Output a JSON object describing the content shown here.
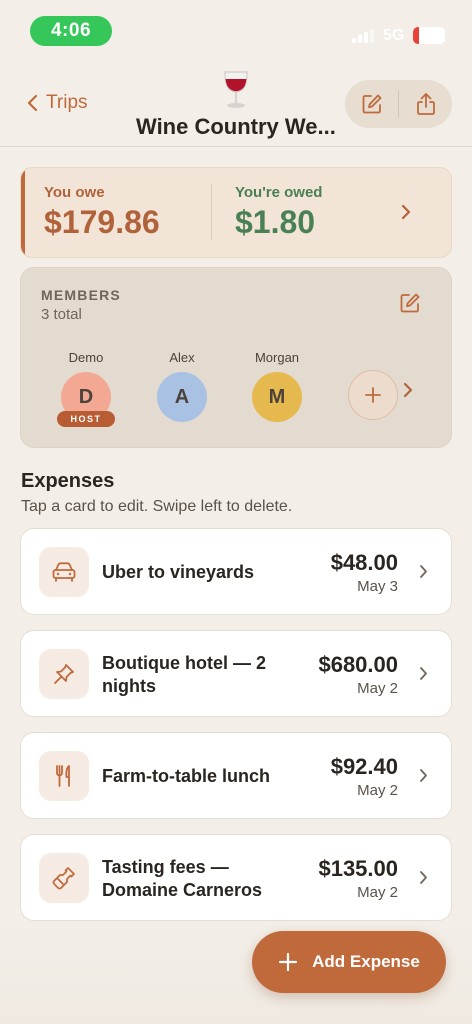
{
  "status_bar": {
    "time": "4:06",
    "network": "5G",
    "battery": "19",
    "battery_level": 0.19
  },
  "header": {
    "back_label": "Trips",
    "title": "Wine Country We...",
    "emoji_icon": "wine-glass-icon",
    "actions": [
      "edit-icon",
      "share-icon"
    ]
  },
  "balance": {
    "you_owe_label": "You owe",
    "you_owe_amount": "$179.86",
    "you_are_owed_label": "You're owed",
    "you_are_owed_amount": "$1.80"
  },
  "members": {
    "title": "MEMBERS",
    "count": "3 total",
    "list": [
      {
        "name": "Demo",
        "initial": "D",
        "badge": "HOST",
        "color": "#f3a894"
      },
      {
        "name": "Alex",
        "initial": "A",
        "color": "#a9c1e3"
      },
      {
        "name": "Morgan",
        "initial": "M",
        "color": "#e6b94f"
      }
    ]
  },
  "expenses": {
    "title": "Expenses",
    "subtitle": "Tap a card to edit. Swipe left to delete.",
    "items": [
      {
        "name": "Uber to vineyards",
        "amount": "$48.00",
        "date": "May 3",
        "icon": "car-icon"
      },
      {
        "name": "Boutique hotel — 2 nights",
        "amount": "$680.00",
        "date": "May 2",
        "icon": "pin-icon"
      },
      {
        "name": "Farm-to-table lunch",
        "amount": "$92.40",
        "date": "May 2",
        "icon": "fork-knife-icon"
      },
      {
        "name": "Tasting fees — Domaine Carneros",
        "amount": "$135.00",
        "date": "May 2",
        "icon": "bottle-icon"
      }
    ]
  },
  "fab": {
    "label": "Add Expense"
  },
  "colors": {
    "accent": "#c06a3c",
    "owed_green": "#4a8055",
    "background": "#f3efe8"
  }
}
